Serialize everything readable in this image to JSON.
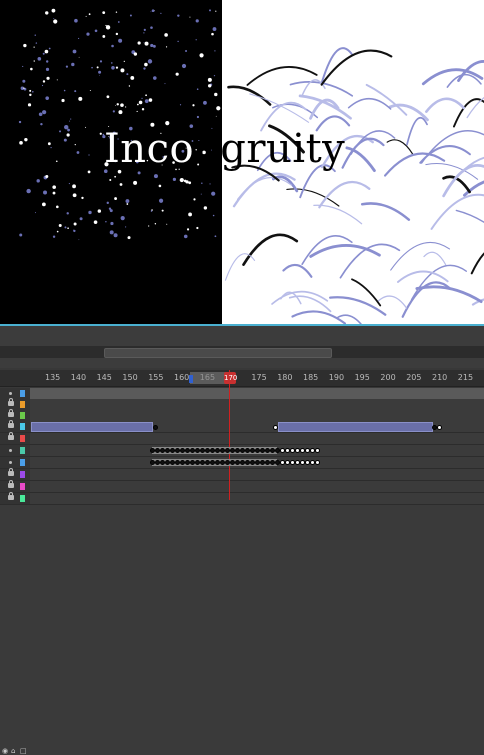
{
  "stage": {
    "title_left": "Inco",
    "title_right": "ngruity",
    "background_left": "#000000",
    "background_right": "#ffffff",
    "accent_purple": "#6a6fb4"
  },
  "timeline": {
    "ruler_labels": [
      "135",
      "140",
      "145",
      "150",
      "155",
      "160",
      "165",
      "170",
      "175",
      "180",
      "185",
      "190",
      "195",
      "200",
      "205",
      "210",
      "215"
    ],
    "current_frame": "170",
    "playhead_color": "#d02020",
    "tween_color": "#6a6fa8",
    "layer_colors": [
      "#4a9ee8",
      "#e89a2a",
      "#6ac84a",
      "#4ac8e8",
      "#e84a4a",
      "#4ac8a8",
      "#4a9ee8",
      "#9a4ae8",
      "#e84ac8",
      "#4ae89a",
      "#c84ae8",
      "#9a4ae8"
    ],
    "icons": {
      "header_eye": "eye-icon",
      "header_lock": "lock-icon",
      "row_lock": "lock-icon",
      "row_visible": "dot-icon"
    }
  }
}
